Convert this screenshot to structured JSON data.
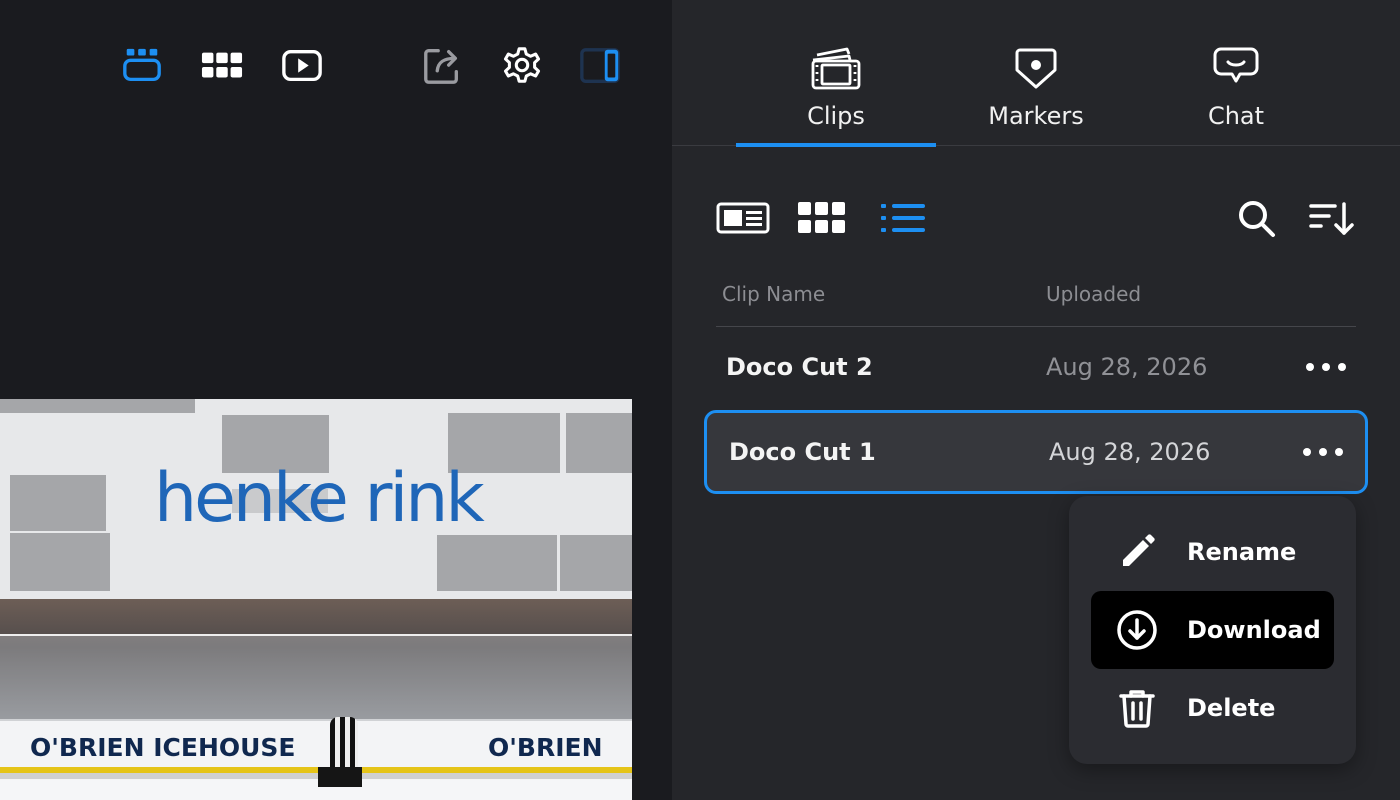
{
  "toolbar": {
    "icons": [
      "player-layout-icon",
      "grid-view-icon",
      "play-video-icon",
      "share-icon",
      "settings-gear-icon",
      "sidebar-toggle-icon"
    ]
  },
  "video": {
    "signage_text": "henke rink",
    "ad_left": "O'BRIEN ICEHOUSE",
    "ad_right": "O'BRIEN"
  },
  "tabs": [
    {
      "label": "Clips",
      "icon": "clips-icon",
      "active": true
    },
    {
      "label": "Markers",
      "icon": "marker-icon",
      "active": false
    },
    {
      "label": "Chat",
      "icon": "chat-icon",
      "active": false
    }
  ],
  "view_controls": {
    "icons": [
      "card-view-icon",
      "grid-view-icon",
      "list-view-icon",
      "search-icon",
      "sort-icon"
    ],
    "active": "list-view-icon"
  },
  "table": {
    "columns": [
      "Clip Name",
      "Uploaded"
    ],
    "rows": [
      {
        "name": "Doco Cut 2",
        "uploaded": "Aug 28, 2026",
        "selected": false
      },
      {
        "name": "Doco Cut 1",
        "uploaded": "Aug 28, 2026",
        "selected": true
      }
    ]
  },
  "context_menu": {
    "items": [
      {
        "label": "Rename",
        "icon": "pencil-icon"
      },
      {
        "label": "Download",
        "icon": "download-icon",
        "highlighted": true
      },
      {
        "label": "Delete",
        "icon": "trash-icon"
      }
    ]
  },
  "colors": {
    "accent": "#1d8ff2",
    "left_bg": "#1a1b1f",
    "panel_bg": "#25262a"
  }
}
